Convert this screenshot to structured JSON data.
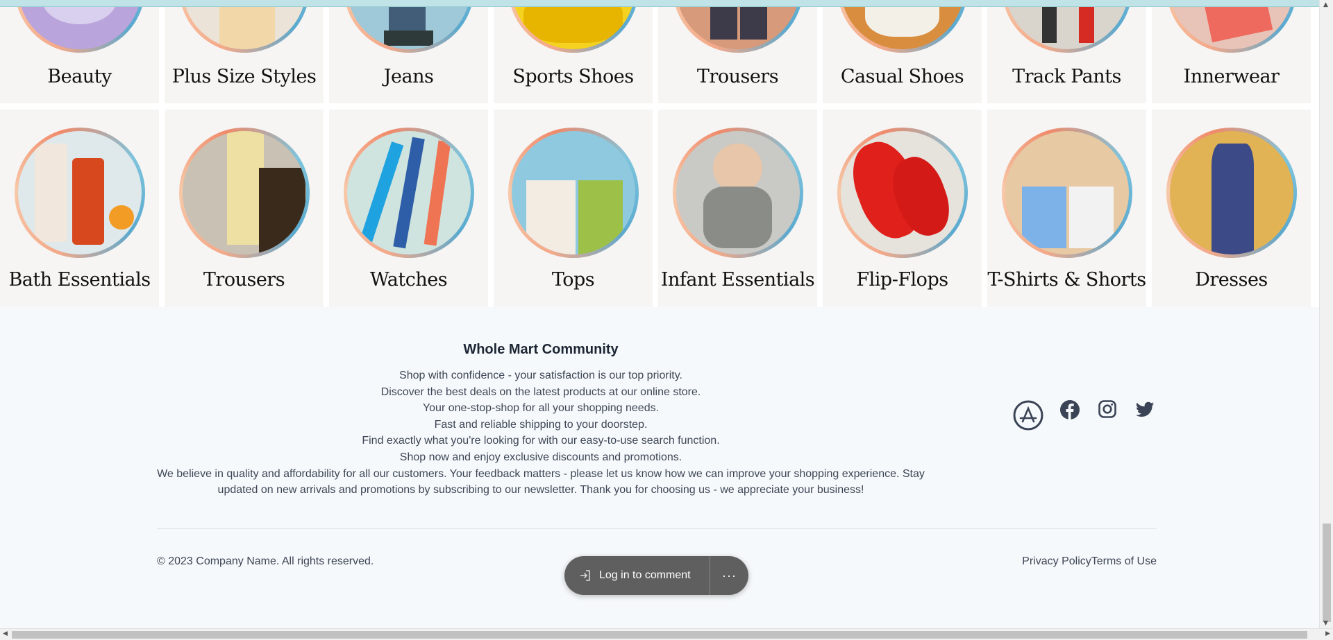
{
  "categories_top": [
    {
      "label": "Beauty",
      "icon": "beauty-image"
    },
    {
      "label": "Plus Size Styles",
      "icon": "plus-size-image"
    },
    {
      "label": "Jeans",
      "icon": "jeans-image"
    },
    {
      "label": "Sports Shoes",
      "icon": "sports-shoes-image"
    },
    {
      "label": "Trousers",
      "icon": "trousers-image"
    },
    {
      "label": "Casual Shoes",
      "icon": "casual-shoes-image"
    },
    {
      "label": "Track Pants",
      "icon": "track-pants-image"
    },
    {
      "label": "Innerwear",
      "icon": "innerwear-image"
    }
  ],
  "categories_bottom": [
    {
      "label": "Bath Essentials",
      "icon": "bath-essentials-image"
    },
    {
      "label": "Trousers",
      "icon": "trousers-image"
    },
    {
      "label": "Watches",
      "icon": "watches-image"
    },
    {
      "label": "Tops",
      "icon": "tops-image"
    },
    {
      "label": "Infant Essentials",
      "icon": "infant-essentials-image"
    },
    {
      "label": "Flip-Flops",
      "icon": "flip-flops-image"
    },
    {
      "label": "T-Shirts & Shorts",
      "icon": "tshirts-shorts-image"
    },
    {
      "label": "Dresses",
      "icon": "dresses-image"
    }
  ],
  "footer": {
    "title": "Whole Mart Community",
    "lines": [
      "Shop with confidence - your satisfaction is our top priority.",
      "Discover the best deals on the latest products at our online store.",
      "Your one-stop-shop for all your shopping needs.",
      "Fast and reliable shipping to your doorstep.",
      "Find exactly what you're looking for with our easy-to-use search function.",
      "Shop now and enjoy exclusive discounts and promotions.",
      "We believe in quality and affordability for all our customers. Your feedback matters - please let us know how we can improve your shopping experience. Stay updated on new arrivals and promotions by subscribing to our newsletter. Thank you for choosing us - we appreciate your business!"
    ],
    "social_icons": [
      "app-store-icon",
      "facebook-icon",
      "instagram-icon",
      "twitter-icon"
    ],
    "copyright": "© 2023 Company Name. All rights reserved.",
    "privacy_label": "Privacy Policy",
    "terms_label": "Terms of Use"
  },
  "comment_pill": {
    "login_label": "Log in to comment",
    "more_label": "···"
  },
  "colors": {
    "tile_bg": "#f6f5f4",
    "footer_bg": "#f6f9fb",
    "pill_bg": "#5f5f5f"
  }
}
